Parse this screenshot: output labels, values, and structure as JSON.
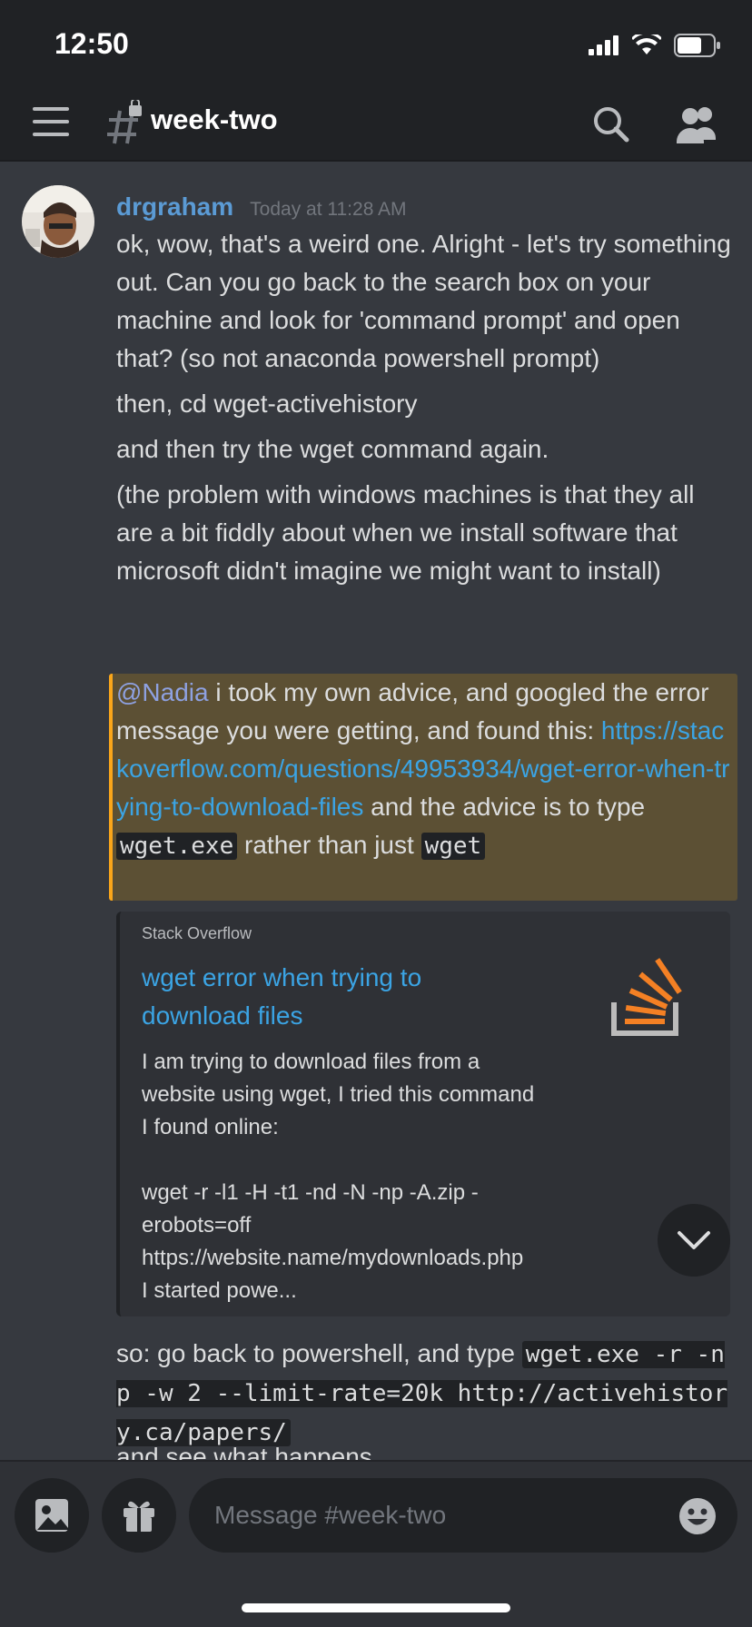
{
  "status_bar": {
    "time": "12:50"
  },
  "header": {
    "channel_name": "week-two"
  },
  "message": {
    "author": "drgraham",
    "timestamp": "Today at 11:28 AM",
    "lines": [
      "ok, wow, that's a weird one. Alright - let's try something out. Can you go back to the search box on your machine and look for 'command prompt' and open that? (so not anaconda powershell prompt)",
      "then, cd wget-activehistory",
      "and then try the wget command again.",
      "(the problem with windows machines is that they all are a bit fiddly about when we install software that microsoft didn't imagine we might want to install)"
    ],
    "mention_message": {
      "mention": "@Nadia",
      "text_before_link": " i took my own advice, and googled the error message you were getting, and found this: ",
      "link": "https://stackoverflow.com/questions/49953934/wget-error-when-trying-to-download-files",
      "text_after_link": " and the advice is to type ",
      "code1": "wget.exe",
      "text_between": " rather than just ",
      "code2": "wget"
    },
    "embed": {
      "provider": "Stack Overflow",
      "title": "wget error when trying to download files",
      "description": "I am trying to download files from a website using wget, I tried this command I found online:\n\nwget -r -l1 -H -t1 -nd -N -np -A.zip -erobots=off https://website.name/mydownloads.php\nI started powe..."
    },
    "last_message": {
      "text_before": "so: go back to powershell, and type ",
      "code": "wget.exe -r -np -w 2 --limit-rate=20k http://activehistory.ca/papers/",
      "after": "and see what happens"
    }
  },
  "input": {
    "placeholder": "Message #week-two"
  },
  "colors": {
    "background": "#36393f",
    "header": "#202225",
    "author": "#5b9bd5",
    "link": "#3ba4e4",
    "mention_highlight": "#5c5034",
    "mention_bar": "#faa61a",
    "stackoverflow_orange": "#f48024"
  }
}
